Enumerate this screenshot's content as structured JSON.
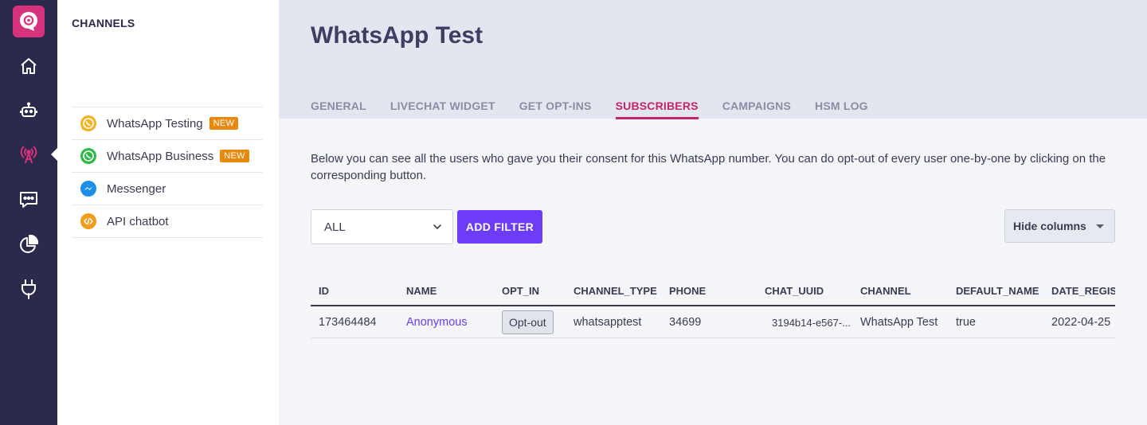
{
  "colors": {
    "rail_bg": "#2b2a4c",
    "logo_bg": "#d8327d",
    "active_tab": "#c4246c",
    "primary_button": "#6c3cf7",
    "badge": "#e8890c"
  },
  "rail": {
    "logo_icon": "chat-bubble-logo-icon",
    "items": [
      {
        "icon": "home-icon"
      },
      {
        "icon": "bot-icon"
      },
      {
        "icon": "broadcast-icon",
        "active": true
      },
      {
        "icon": "chat-icon"
      },
      {
        "icon": "pie-chart-icon"
      },
      {
        "icon": "plug-icon"
      }
    ]
  },
  "channels": {
    "heading": "CHANNELS",
    "items": [
      {
        "label": "WhatsApp Testing",
        "badge": "NEW",
        "icon": "whatsapp-testing-icon"
      },
      {
        "label": "WhatsApp Business",
        "badge": "NEW",
        "icon": "whatsapp-icon"
      },
      {
        "label": "Messenger",
        "icon": "messenger-icon"
      },
      {
        "label": "API chatbot",
        "icon": "api-chatbot-icon"
      }
    ]
  },
  "header": {
    "title": "WhatsApp Test",
    "tabs": [
      {
        "label": "GENERAL"
      },
      {
        "label": "LIVECHAT WIDGET"
      },
      {
        "label": "GET OPT-INS"
      },
      {
        "label": "SUBSCRIBERS",
        "active": true
      },
      {
        "label": "CAMPAIGNS"
      },
      {
        "label": "HSM LOG"
      }
    ]
  },
  "content": {
    "description": "Below you can see all the users who gave you their consent for this WhatsApp number. You can do opt-out of every user one-by-one by clicking on the corresponding button.",
    "filter_select": "ALL",
    "add_filter_label": "ADD FILTER",
    "hide_columns_label": "Hide columns"
  },
  "table": {
    "columns": [
      "ID",
      "NAME",
      "OPT_IN",
      "CHANNEL_TYPE",
      "PHONE",
      "CHAT_UUID",
      "CHANNEL",
      "DEFAULT_NAME",
      "DATE_REGISTERED"
    ],
    "rows": [
      {
        "id": "173464484",
        "name": "Anonymous",
        "opt_in": "Opt-out",
        "channel_type": "whatsapptest",
        "phone": "34699",
        "chat_uuid": "3194b14-e567-...",
        "channel": "WhatsApp Test",
        "default_name": "true",
        "date_registered": "2022-04-25"
      }
    ]
  }
}
